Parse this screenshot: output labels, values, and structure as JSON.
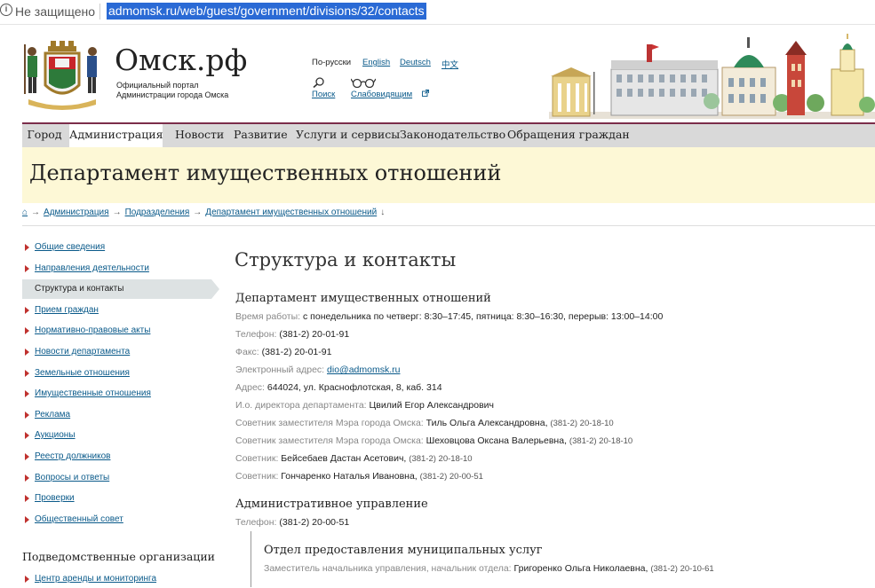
{
  "browser": {
    "security": "Не защищено",
    "info_glyph": "i",
    "url": "admomsk.ru/web/guest/government/divisions/32/contacts"
  },
  "header": {
    "site_title": "Омск.рф",
    "subtitle_line1": "Официальный портал",
    "subtitle_line2": "Администрации города Омска",
    "languages": [
      "По-русски",
      "English",
      "Deutsch",
      "中文"
    ],
    "tools": {
      "search": "Поиск",
      "low_vision": "Слабовидящим"
    }
  },
  "nav": {
    "items": [
      "Город",
      "Администрация",
      "Новости",
      "Развитие",
      "Услуги и сервисы",
      "Законодательство",
      "Обращения граждан"
    ],
    "active": "Администрация"
  },
  "banner": {
    "title": "Департамент имущественных отношений"
  },
  "breadcrumbs": {
    "home_glyph": "⌂",
    "arrow": "→",
    "items": [
      "Администрация",
      "Подразделения",
      "Департамент имущественных отношений"
    ],
    "tail": "↓"
  },
  "sidebar": {
    "items": [
      "Общие сведения",
      "Направления деятельности",
      "Структура и контакты",
      "Прием граждан",
      "Нормативно-правовые акты",
      "Новости департамента",
      "Земельные отношения",
      "Имущественные отношения",
      "Реклама",
      "Аукционы",
      "Реестр должников",
      "Вопросы и ответы",
      "Проверки",
      "Общественный совет"
    ],
    "active": "Структура и контакты",
    "subordinate_title": "Подведомственные организации",
    "subordinate_items": [
      "Центр аренды и мониторинга"
    ]
  },
  "content": {
    "title": "Структура и контакты",
    "dept": {
      "name": "Департамент имущественных отношений",
      "hours_label": "Время работы:",
      "hours": "с понедельника по четверг: 8:30–17:45, пятница: 8:30–16:30, перерыв: 13:00–14:00",
      "phone_label": "Телефон:",
      "phone": "(381-2) 20-01-91",
      "fax_label": "Факс:",
      "fax": "(381-2) 20-01-91",
      "email_label": "Электронный адрес:",
      "email": "dio@admomsk.ru",
      "address_label": "Адрес:",
      "address": "644024, ул. Краснофлотская, 8, каб. 314",
      "director_label": "И.о. директора департамента:",
      "director": "Цвилий Егор Александрович",
      "staff": [
        {
          "label": "Советник заместителя Мэра города Омска:",
          "name": "Тиль Ольга Александровна,",
          "phone": "(381-2) 20-18-10"
        },
        {
          "label": "Советник заместителя Мэра города Омска:",
          "name": "Шеховцова Оксана Валерьевна,",
          "phone": "(381-2) 20-18-10"
        },
        {
          "label": "Советник:",
          "name": "Бейсебаев Дастан Асетович,",
          "phone": "(381-2) 20-18-10"
        },
        {
          "label": "Советник:",
          "name": "Гончаренко Наталья Ивановна,",
          "phone": "(381-2) 20-00-51"
        }
      ]
    },
    "admin": {
      "name": "Административное управление",
      "phone_label": "Телефон:",
      "phone": "(381-2) 20-00-51",
      "subdept": {
        "name": "Отдел предоставления муниципальных услуг",
        "head_label": "Заместитель начальника управления, начальник отдела:",
        "head": "Григоренко Ольга Николаевна,",
        "phone": "(381-2) 20-10-61"
      }
    }
  },
  "colors": {
    "link": "#0a5a8a",
    "accent": "#7b2d4a",
    "bullet": "#c0322f",
    "banner_bg": "#fdf8d6",
    "url_highlight": "#2a6ad5"
  },
  "icons": {
    "search": "magnifier-icon",
    "low_vision": "glasses-icon",
    "external": "external-link-icon"
  }
}
